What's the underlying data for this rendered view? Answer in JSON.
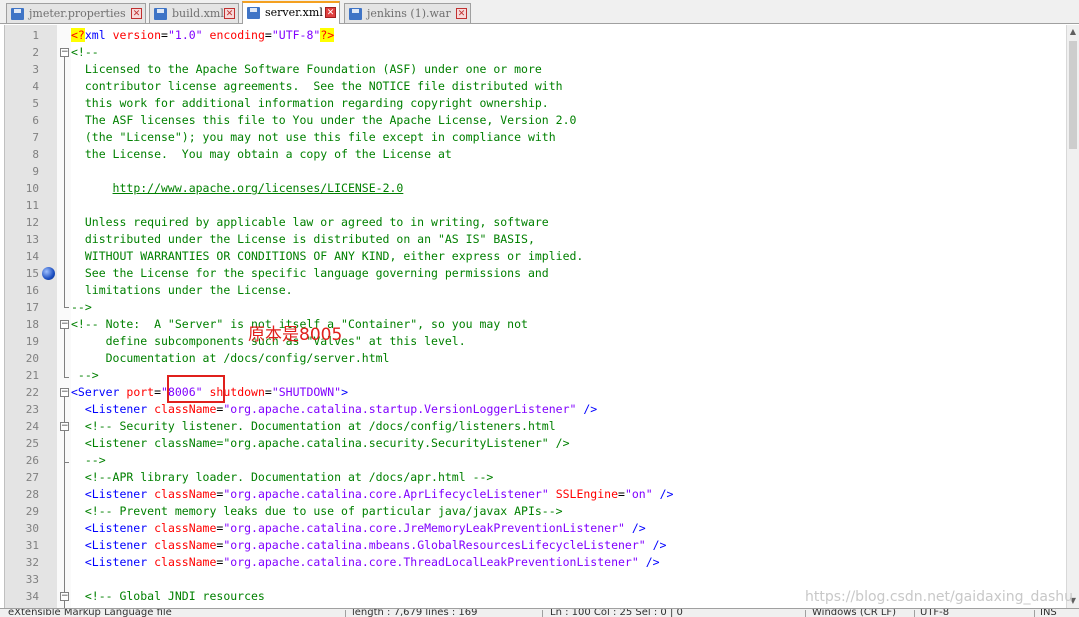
{
  "tabs": [
    {
      "label": "jmeter.properties",
      "active": false
    },
    {
      "label": "build.xml",
      "active": false
    },
    {
      "label": "server.xml",
      "active": true
    },
    {
      "label": "jenkins (1).war",
      "active": false
    }
  ],
  "lines": [
    {
      "n": "1",
      "segs": [
        [
          "pi",
          "<?"
        ],
        [
          "tag",
          "xml "
        ],
        [
          "attr",
          "version"
        ],
        [
          "",
          "="
        ],
        [
          "val",
          "\"1.0\""
        ],
        [
          "attr",
          " encoding"
        ],
        [
          "",
          "="
        ],
        [
          "val",
          "\"UTF-8\""
        ],
        [
          "pi",
          "?>"
        ]
      ]
    },
    {
      "n": "2",
      "segs": [
        [
          "comment",
          "<!--"
        ]
      ]
    },
    {
      "n": "3",
      "segs": [
        [
          "comment",
          "  Licensed to the Apache Software Foundation (ASF) under one or more"
        ]
      ]
    },
    {
      "n": "4",
      "segs": [
        [
          "comment",
          "  contributor license agreements.  See the NOTICE file distributed with"
        ]
      ]
    },
    {
      "n": "5",
      "segs": [
        [
          "comment",
          "  this work for additional information regarding copyright ownership."
        ]
      ]
    },
    {
      "n": "6",
      "segs": [
        [
          "comment",
          "  The ASF licenses this file to You under the Apache License, Version 2.0"
        ]
      ]
    },
    {
      "n": "7",
      "segs": [
        [
          "comment",
          "  (the \"License\"); you may not use this file except in compliance with"
        ]
      ]
    },
    {
      "n": "8",
      "segs": [
        [
          "comment",
          "  the License.  You may obtain a copy of the License at"
        ]
      ]
    },
    {
      "n": "9",
      "segs": [
        [
          "comment",
          ""
        ]
      ]
    },
    {
      "n": "10",
      "segs": [
        [
          "comment",
          "      "
        ],
        [
          "link",
          "http://www.apache.org/licenses/LICENSE-2.0"
        ]
      ]
    },
    {
      "n": "11",
      "segs": [
        [
          "comment",
          ""
        ]
      ]
    },
    {
      "n": "12",
      "segs": [
        [
          "comment",
          "  Unless required by applicable law or agreed to in writing, software"
        ]
      ]
    },
    {
      "n": "13",
      "segs": [
        [
          "comment",
          "  distributed under the License is distributed on an \"AS IS\" BASIS,"
        ]
      ]
    },
    {
      "n": "14",
      "segs": [
        [
          "comment",
          "  WITHOUT WARRANTIES OR CONDITIONS OF ANY KIND, either express or implied."
        ]
      ]
    },
    {
      "n": "15",
      "segs": [
        [
          "comment",
          "  See the License for the specific language governing permissions and"
        ]
      ]
    },
    {
      "n": "16",
      "segs": [
        [
          "comment",
          "  limitations under the License."
        ]
      ]
    },
    {
      "n": "17",
      "segs": [
        [
          "comment",
          "-->"
        ]
      ]
    },
    {
      "n": "18",
      "segs": [
        [
          "comment",
          "<!-- Note:  A \"Server\" is not itself a \"Container\", so you may not"
        ]
      ]
    },
    {
      "n": "19",
      "segs": [
        [
          "comment",
          "     define subcomponents such as \"Valves\" at this level."
        ]
      ]
    },
    {
      "n": "20",
      "segs": [
        [
          "comment",
          "     Documentation at /docs/config/server.html"
        ]
      ]
    },
    {
      "n": "21",
      "segs": [
        [
          "comment",
          " -->"
        ]
      ]
    },
    {
      "n": "22",
      "segs": [
        [
          "tag",
          "<Server "
        ],
        [
          "attr",
          "port"
        ],
        [
          "",
          "="
        ],
        [
          "val",
          "\"8006\""
        ],
        [
          "attr",
          " shutdown"
        ],
        [
          "",
          "="
        ],
        [
          "val",
          "\"SHUTDOWN\""
        ],
        [
          "tag",
          ">"
        ]
      ]
    },
    {
      "n": "23",
      "segs": [
        [
          "tag",
          "  <Listener "
        ],
        [
          "attr",
          "className"
        ],
        [
          "",
          "="
        ],
        [
          "val",
          "\"org.apache.catalina.startup.VersionLoggerListener\""
        ],
        [
          "tag",
          " />"
        ]
      ]
    },
    {
      "n": "24",
      "segs": [
        [
          "comment",
          "  <!-- Security listener. Documentation at /docs/config/listeners.html"
        ]
      ]
    },
    {
      "n": "25",
      "segs": [
        [
          "comment",
          "  <Listener className=\"org.apache.catalina.security.SecurityListener\" />"
        ]
      ]
    },
    {
      "n": "26",
      "segs": [
        [
          "comment",
          "  -->"
        ]
      ]
    },
    {
      "n": "27",
      "segs": [
        [
          "comment",
          "  <!--APR library loader. Documentation at /docs/apr.html -->"
        ]
      ]
    },
    {
      "n": "28",
      "segs": [
        [
          "tag",
          "  <Listener "
        ],
        [
          "attr",
          "className"
        ],
        [
          "",
          "="
        ],
        [
          "val",
          "\"org.apache.catalina.core.AprLifecycleListener\""
        ],
        [
          "attr",
          " SSLEngine"
        ],
        [
          "",
          "="
        ],
        [
          "val",
          "\"on\""
        ],
        [
          "tag",
          " />"
        ]
      ]
    },
    {
      "n": "29",
      "segs": [
        [
          "comment",
          "  <!-- Prevent memory leaks due to use of particular java/javax APIs-->"
        ]
      ]
    },
    {
      "n": "30",
      "segs": [
        [
          "tag",
          "  <Listener "
        ],
        [
          "attr",
          "className"
        ],
        [
          "",
          "="
        ],
        [
          "val",
          "\"org.apache.catalina.core.JreMemoryLeakPreventionListener\""
        ],
        [
          "tag",
          " />"
        ]
      ]
    },
    {
      "n": "31",
      "segs": [
        [
          "tag",
          "  <Listener "
        ],
        [
          "attr",
          "className"
        ],
        [
          "",
          "="
        ],
        [
          "val",
          "\"org.apache.catalina.mbeans.GlobalResourcesLifecycleListener\""
        ],
        [
          "tag",
          " />"
        ]
      ]
    },
    {
      "n": "32",
      "segs": [
        [
          "tag",
          "  <Listener "
        ],
        [
          "attr",
          "className"
        ],
        [
          "",
          "="
        ],
        [
          "val",
          "\"org.apache.catalina.core.ThreadLocalLeakPreventionListener\""
        ],
        [
          "tag",
          " />"
        ]
      ]
    },
    {
      "n": "33",
      "segs": [
        [
          "",
          ""
        ]
      ]
    },
    {
      "n": "34",
      "segs": [
        [
          "comment",
          "  <!-- Global JNDI resources"
        ]
      ]
    }
  ],
  "annotation": "原本是8005",
  "highlighted_value": "\"8006\"",
  "bookmark_line": "15",
  "status": {
    "file_type": "eXtensible Markup Language file",
    "length": "length : 7,679    lines : 169",
    "position": "Ln : 100    Col : 25    Sel : 0 | 0",
    "eol": "Windows (CR LF)",
    "encoding": "UTF-8",
    "mode": "INS"
  },
  "watermark": "https://blog.csdn.net/gaidaxing_dashu",
  "colors": {
    "comment": "#008000",
    "tag": "#0000ff",
    "attr": "#ff0000",
    "value": "#8000ff",
    "accent_tab": "#f4a020",
    "annotation": "#e0201c"
  }
}
